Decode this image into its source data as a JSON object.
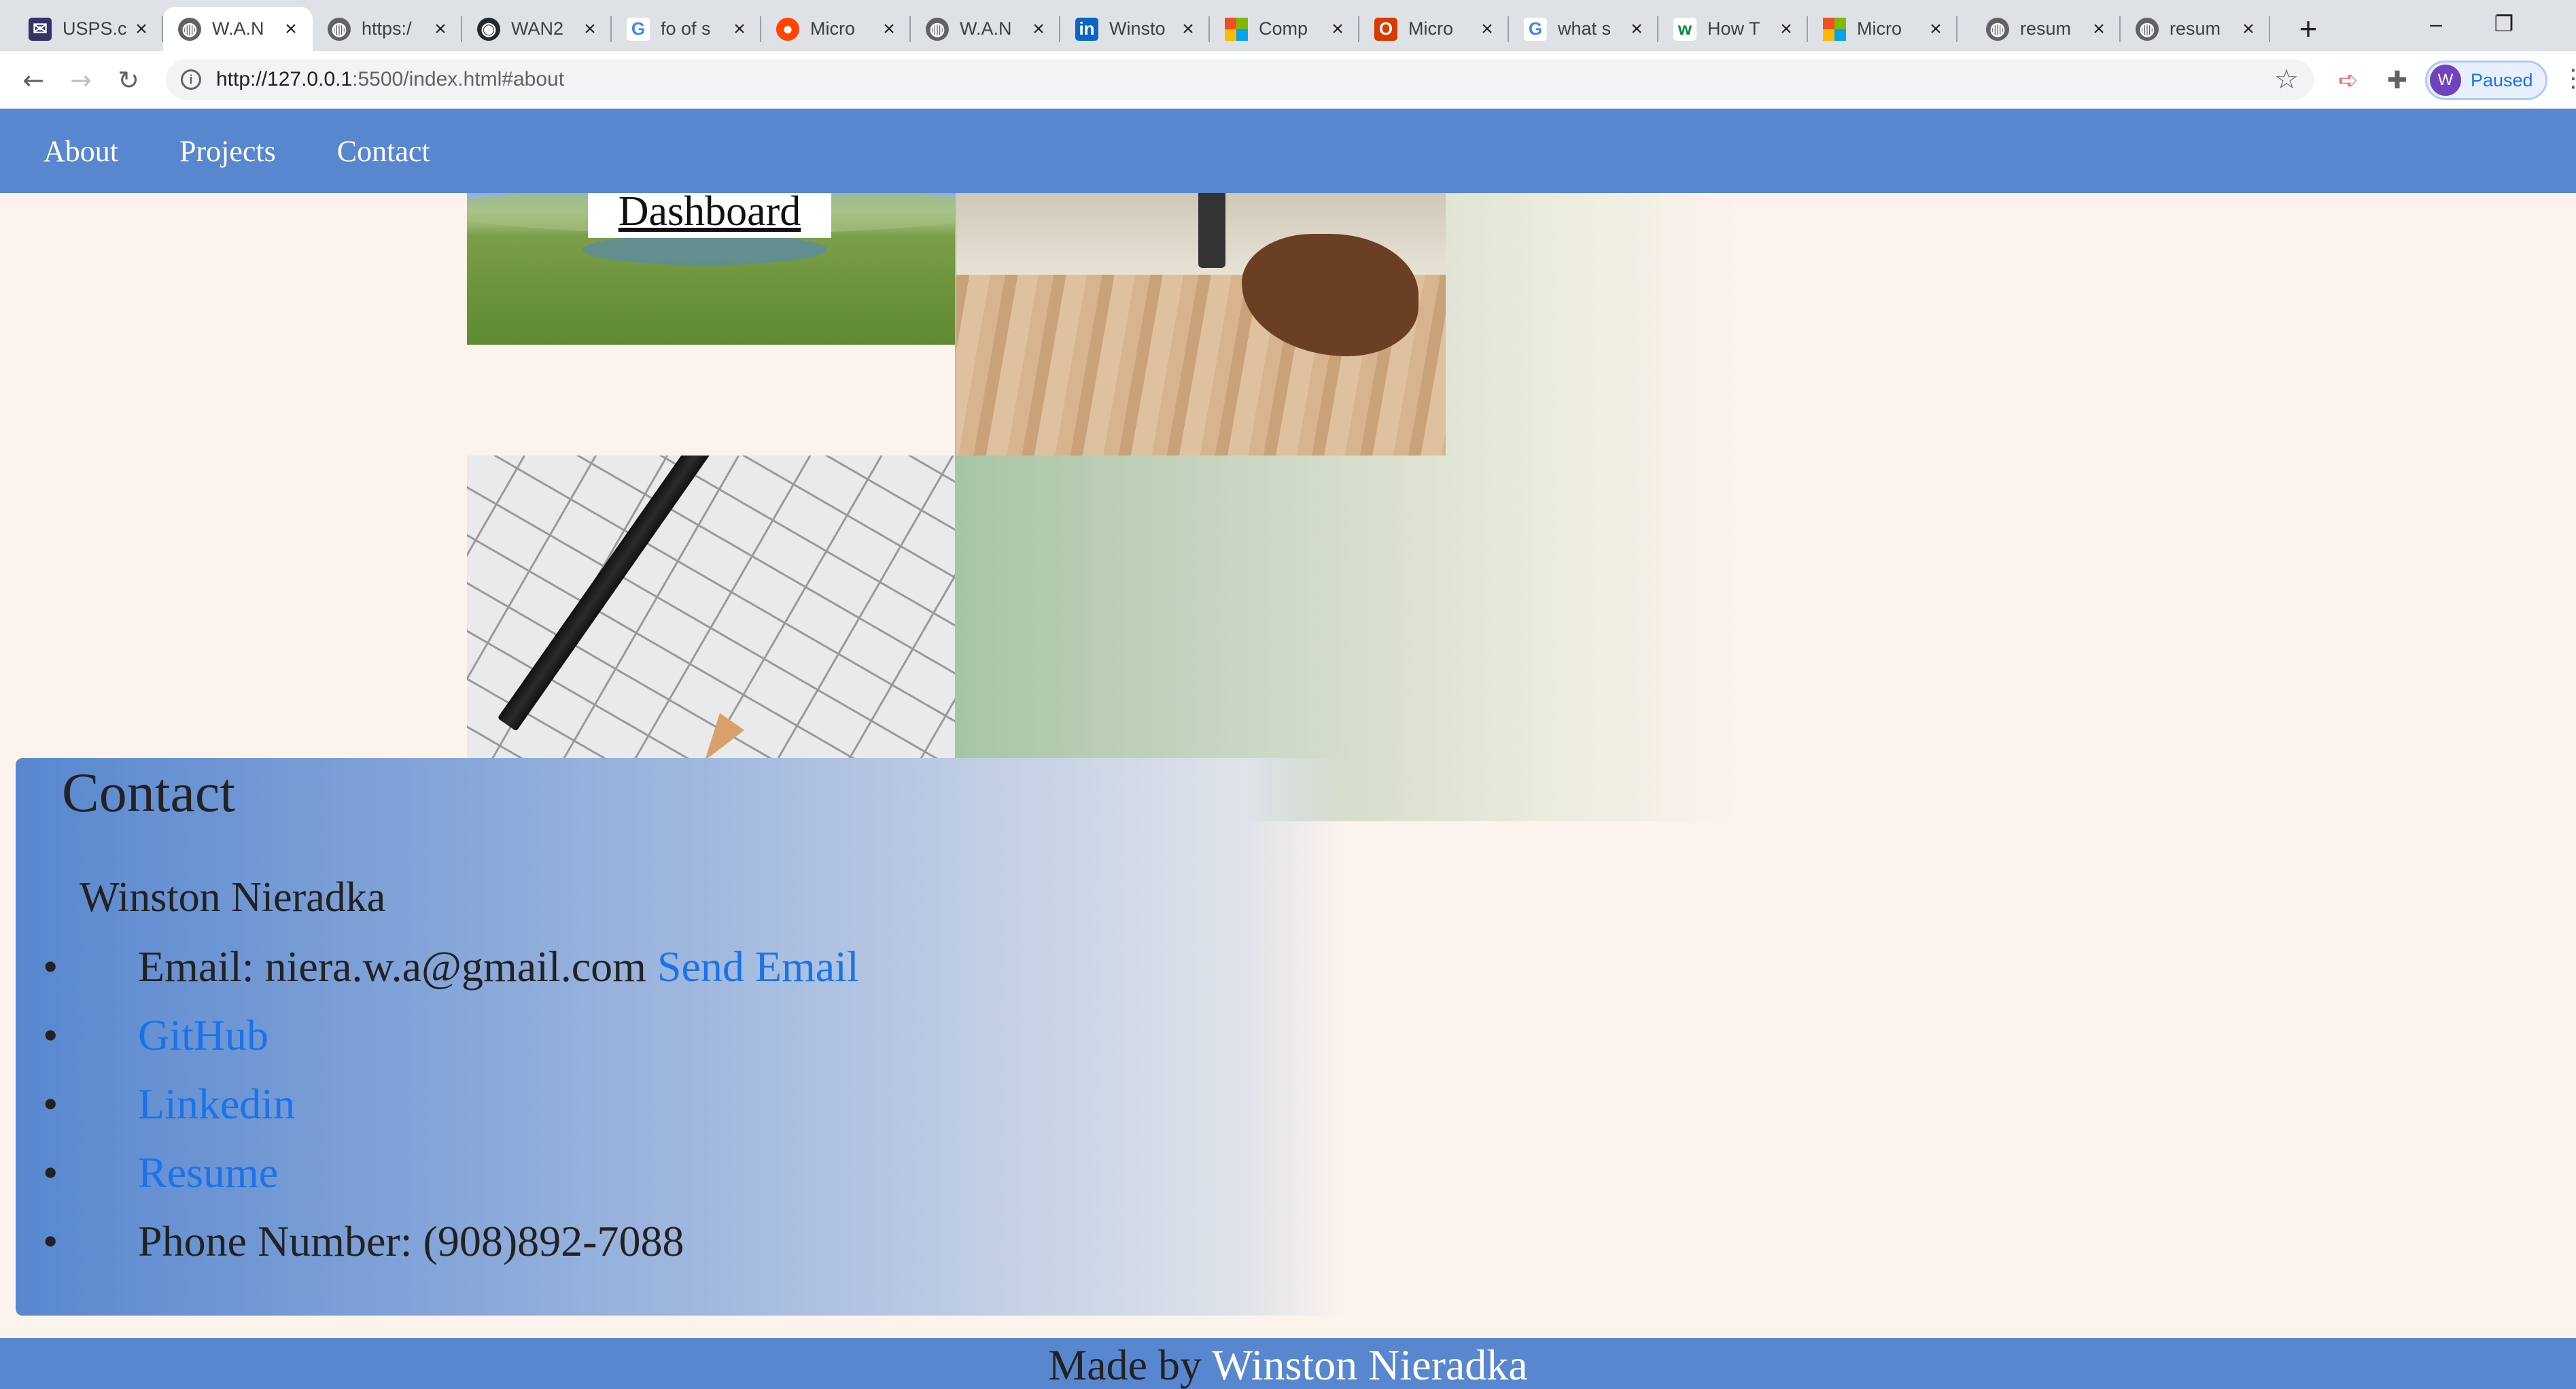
{
  "browser": {
    "tabs": [
      {
        "title": "USPS.c",
        "favicon": "usps-icon"
      },
      {
        "title": "W.A.N",
        "favicon": "globe-icon",
        "active": true
      },
      {
        "title": "https:/",
        "favicon": "globe-icon"
      },
      {
        "title": "WAN2",
        "favicon": "github-icon"
      },
      {
        "title": "fo of s",
        "favicon": "google-icon"
      },
      {
        "title": "Micro",
        "favicon": "reddit-icon"
      },
      {
        "title": "W.A.N",
        "favicon": "globe-icon"
      },
      {
        "title": "Winsto",
        "favicon": "linkedin-icon"
      },
      {
        "title": "Comp",
        "favicon": "microsoft-icon"
      },
      {
        "title": "Micro",
        "favicon": "office-icon"
      },
      {
        "title": "what s",
        "favicon": "google-icon"
      },
      {
        "title": "How T",
        "favicon": "wikihow-icon"
      },
      {
        "title": "Micro",
        "favicon": "microsoft-icon"
      },
      {
        "title": "resum",
        "favicon": "globe-icon"
      },
      {
        "title": "resum",
        "favicon": "globe-icon"
      }
    ],
    "url_host": "http://127.0.0.1",
    "url_rest": ":5500/index.html#about",
    "profile_initial": "W",
    "profile_status": "Paused"
  },
  "site": {
    "nav": [
      "About",
      "Projects",
      "Contact"
    ],
    "project_label": "Dashboard",
    "contact": {
      "heading": "Contact",
      "name": "Winston Nieradka",
      "email_text": "Email: niera.w.a@gmail.com",
      "send_email": "Send Email",
      "github": "GitHub",
      "linkedin": "Linkedin",
      "resume": "Resume",
      "phone": "Phone Number: (908)892-7088"
    },
    "footer": {
      "prefix": "Made by ",
      "author": "Winston Nieradka"
    }
  },
  "colors": {
    "nav_bg": "#5887cf",
    "page_bg": "#fdf3ed",
    "link": "#1a73e8"
  }
}
